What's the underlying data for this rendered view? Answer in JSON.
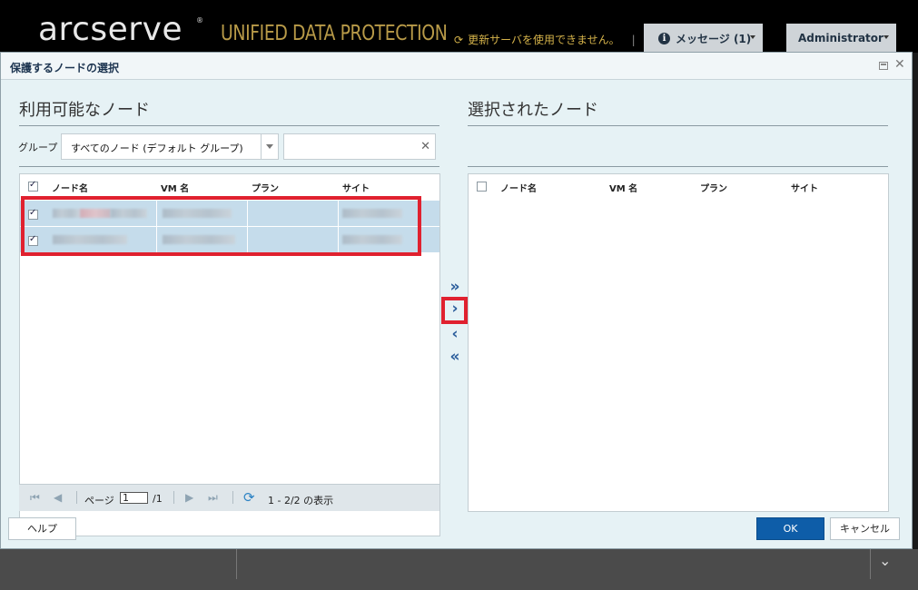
{
  "app": {
    "logo": "arcserve",
    "logo_mark": "®",
    "product": "UNIFIED DATA PROTECTION",
    "update_warning": "更新サーバを使用できません。",
    "update_separator": "|",
    "messages_label": "メッセージ (1)",
    "info_glyph": "i",
    "user_label": "Administrator"
  },
  "dialog": {
    "title": "保護するノードの選択",
    "left": {
      "title": "利用可能なノード",
      "group_label": "グループ",
      "group_value": "すべてのノード (デフォルト グループ)",
      "search_value": "",
      "columns": [
        "ノード名",
        "VM 名",
        "プラン",
        "サイト"
      ],
      "rows": [
        {
          "checked": true,
          "node": "",
          "vm": "",
          "plan": "",
          "site": ""
        },
        {
          "checked": true,
          "node": "",
          "vm": "",
          "plan": "",
          "site": ""
        }
      ],
      "header_checked": true
    },
    "right": {
      "title": "選択されたノード",
      "columns": [
        "ノード名",
        "VM 名",
        "プラン",
        "サイト"
      ]
    },
    "pager": {
      "page_label": "ページ",
      "page_value": "1",
      "page_total": "/1",
      "summary": "1 - 2/2 の表示"
    },
    "movers": {
      "add_all": "»",
      "add": "›",
      "remove": "‹",
      "remove_all": "«"
    },
    "buttons": {
      "help": "ヘルプ",
      "ok": "OK",
      "cancel": "キャンセル"
    }
  },
  "colors": {
    "accent": "#0e5da8",
    "highlight": "#e0212f",
    "selected_row": "#c5dceb",
    "product_gold": "#b89a48"
  }
}
